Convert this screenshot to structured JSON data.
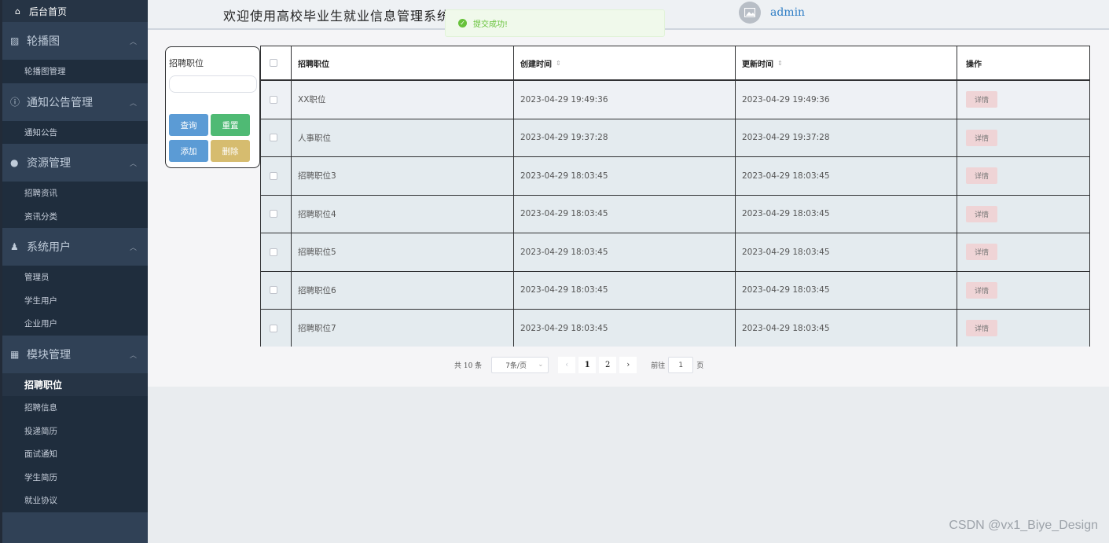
{
  "header": {
    "welcome": "欢迎使用高校毕业生就业信息管理系统",
    "username": "admin"
  },
  "toast": {
    "message": "提交成功!"
  },
  "sidebar": {
    "home": "后台首页",
    "groups": [
      {
        "title": "轮播图",
        "icon": "image-icon",
        "items": [
          "轮播图管理"
        ]
      },
      {
        "title": "通知公告管理",
        "icon": "info-icon",
        "items": [
          "通知公告"
        ]
      },
      {
        "title": "资源管理",
        "icon": "location-icon",
        "items": [
          "招聘资讯",
          "资讯分类"
        ]
      },
      {
        "title": "系统用户",
        "icon": "user-icon",
        "items": [
          "管理员",
          "学生用户",
          "企业用户"
        ]
      },
      {
        "title": "模块管理",
        "icon": "grid-icon",
        "items": [
          "招聘职位",
          "招聘信息",
          "投递简历",
          "面试通知",
          "学生简历",
          "就业协议"
        ]
      }
    ],
    "active_item": "招聘职位"
  },
  "search": {
    "label": "招聘职位",
    "value": "",
    "query": "查询",
    "reset": "重置",
    "add": "添加",
    "delete": "删除"
  },
  "table": {
    "columns": [
      "招聘职位",
      "创建时间",
      "更新时间",
      "操作"
    ],
    "rows": [
      {
        "title": "XX职位",
        "created": "2023-04-29 19:49:36",
        "updated": "2023-04-29 19:49:36"
      },
      {
        "title": "人事职位",
        "created": "2023-04-29 19:37:28",
        "updated": "2023-04-29 19:37:28"
      },
      {
        "title": "招聘职位3",
        "created": "2023-04-29 18:03:45",
        "updated": "2023-04-29 18:03:45"
      },
      {
        "title": "招聘职位4",
        "created": "2023-04-29 18:03:45",
        "updated": "2023-04-29 18:03:45"
      },
      {
        "title": "招聘职位5",
        "created": "2023-04-29 18:03:45",
        "updated": "2023-04-29 18:03:45"
      },
      {
        "title": "招聘职位6",
        "created": "2023-04-29 18:03:45",
        "updated": "2023-04-29 18:03:45"
      },
      {
        "title": "招聘职位7",
        "created": "2023-04-29 18:03:45",
        "updated": "2023-04-29 18:03:45"
      }
    ],
    "detail_label": "详情"
  },
  "pagination": {
    "total": "共 10 条",
    "page_size": "7条/页",
    "pages": [
      "1",
      "2"
    ],
    "current_page": "1",
    "goto_prefix": "前往",
    "goto_value": "1",
    "goto_suffix": "页"
  },
  "watermark": "CSDN @vx1_Biye_Design"
}
